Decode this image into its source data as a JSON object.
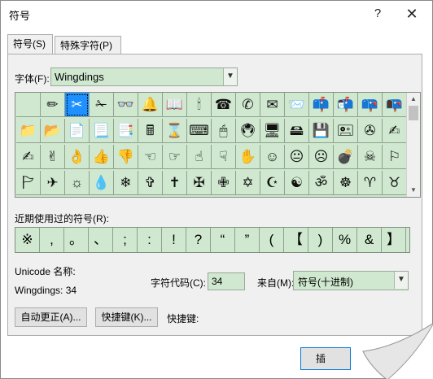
{
  "window": {
    "title": "符号",
    "help": "?",
    "close": "✕"
  },
  "tabs": [
    {
      "label": "符号(S)",
      "active": true
    },
    {
      "label": "特殊字符(P)",
      "active": false
    }
  ],
  "font": {
    "label": "字体(F):",
    "value": "Wingdings"
  },
  "symbol_grid": {
    "rows": [
      [
        "",
        "✏",
        "✂",
        "✁",
        "👓",
        "🔔",
        "📖",
        "🕯",
        "☎",
        "✆",
        "✉",
        "📨",
        "📫",
        "📬",
        "📪",
        "📭"
      ],
      [
        "📁",
        "📂",
        "📄",
        "📃",
        "📑",
        "🖩",
        "⌛",
        "⌨",
        "🖱",
        "🖲",
        "🖥",
        "🖴",
        "💾",
        "🖭",
        "✇",
        "✍"
      ],
      [
        "✍",
        "✌",
        "👌",
        "👍",
        "👎",
        "☜",
        "☞",
        "☝",
        "☟",
        "✋",
        "☺",
        "😐",
        "☹",
        "💣",
        "☠",
        "⚐"
      ],
      [
        "🏱",
        "✈",
        "☼",
        "💧",
        "❄",
        "✞",
        "✝",
        "✠",
        "✙",
        "✡",
        "☪",
        "☯",
        "ॐ",
        "☸",
        "♈",
        "♉"
      ]
    ],
    "selected": "✂"
  },
  "recent": {
    "label": "近期使用过的符号(R):",
    "symbols": [
      "※",
      ",",
      "。",
      "、",
      ";",
      ":",
      "!",
      "?",
      "“",
      "”",
      "(",
      "【",
      ")",
      "%",
      "&",
      "】"
    ]
  },
  "unicode": {
    "label": "Unicode 名称:",
    "value": "Wingdings: 34"
  },
  "char_code": {
    "label": "字符代码(C):",
    "value": "34"
  },
  "from": {
    "label": "来自(M):",
    "value": "符号(十进制)"
  },
  "buttons": {
    "autocorrect": "自动更正(A)...",
    "shortcut_key": "快捷键(K)...",
    "shortcut_label": "快捷键:",
    "insert": "插"
  }
}
